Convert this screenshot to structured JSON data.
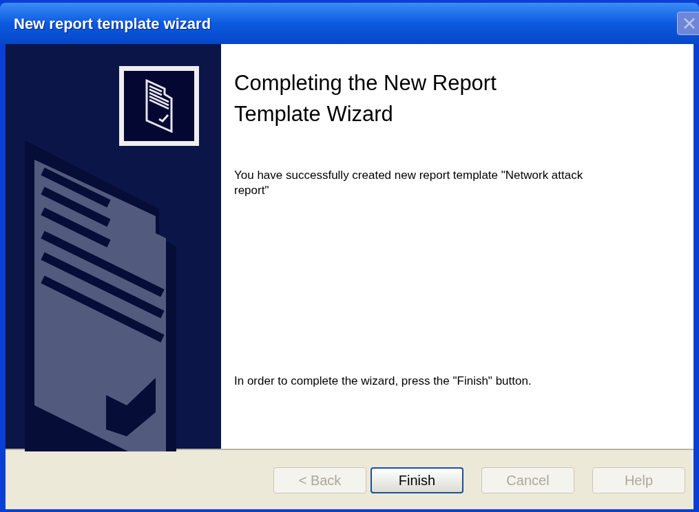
{
  "window": {
    "title": "New report template wizard",
    "close_disabled": true
  },
  "heading": "Completing the New Report Template Wizard",
  "message": "You have successfully created new report template \"Network attack report\"",
  "instruction": "In order to complete the wizard, press the \"Finish\" button.",
  "buttons": [
    {
      "label": "< Back",
      "disabled": true,
      "default": false
    },
    {
      "label": "Finish",
      "disabled": false,
      "default": true
    },
    {
      "label": "Cancel",
      "disabled": true,
      "default": false
    },
    {
      "label": "Help",
      "disabled": true,
      "default": false
    }
  ]
}
